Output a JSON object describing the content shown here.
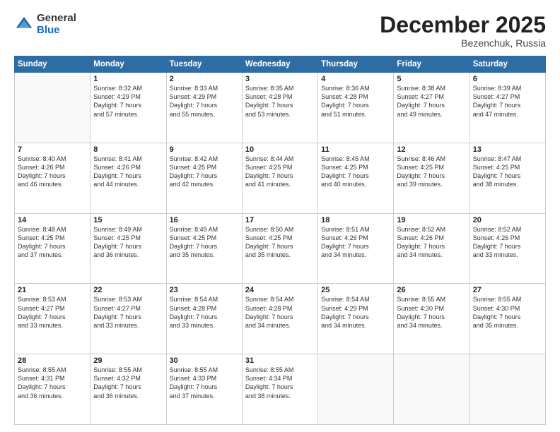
{
  "header": {
    "logo_general": "General",
    "logo_blue": "Blue",
    "month_title": "December 2025",
    "location": "Bezenchuk, Russia"
  },
  "days_of_week": [
    "Sunday",
    "Monday",
    "Tuesday",
    "Wednesday",
    "Thursday",
    "Friday",
    "Saturday"
  ],
  "weeks": [
    [
      {
        "day": "",
        "info": ""
      },
      {
        "day": "1",
        "info": "Sunrise: 8:32 AM\nSunset: 4:29 PM\nDaylight: 7 hours\nand 57 minutes."
      },
      {
        "day": "2",
        "info": "Sunrise: 8:33 AM\nSunset: 4:29 PM\nDaylight: 7 hours\nand 55 minutes."
      },
      {
        "day": "3",
        "info": "Sunrise: 8:35 AM\nSunset: 4:28 PM\nDaylight: 7 hours\nand 53 minutes."
      },
      {
        "day": "4",
        "info": "Sunrise: 8:36 AM\nSunset: 4:28 PM\nDaylight: 7 hours\nand 51 minutes."
      },
      {
        "day": "5",
        "info": "Sunrise: 8:38 AM\nSunset: 4:27 PM\nDaylight: 7 hours\nand 49 minutes."
      },
      {
        "day": "6",
        "info": "Sunrise: 8:39 AM\nSunset: 4:27 PM\nDaylight: 7 hours\nand 47 minutes."
      }
    ],
    [
      {
        "day": "7",
        "info": "Sunrise: 8:40 AM\nSunset: 4:26 PM\nDaylight: 7 hours\nand 46 minutes."
      },
      {
        "day": "8",
        "info": "Sunrise: 8:41 AM\nSunset: 4:26 PM\nDaylight: 7 hours\nand 44 minutes."
      },
      {
        "day": "9",
        "info": "Sunrise: 8:42 AM\nSunset: 4:25 PM\nDaylight: 7 hours\nand 42 minutes."
      },
      {
        "day": "10",
        "info": "Sunrise: 8:44 AM\nSunset: 4:25 PM\nDaylight: 7 hours\nand 41 minutes."
      },
      {
        "day": "11",
        "info": "Sunrise: 8:45 AM\nSunset: 4:25 PM\nDaylight: 7 hours\nand 40 minutes."
      },
      {
        "day": "12",
        "info": "Sunrise: 8:46 AM\nSunset: 4:25 PM\nDaylight: 7 hours\nand 39 minutes."
      },
      {
        "day": "13",
        "info": "Sunrise: 8:47 AM\nSunset: 4:25 PM\nDaylight: 7 hours\nand 38 minutes."
      }
    ],
    [
      {
        "day": "14",
        "info": "Sunrise: 8:48 AM\nSunset: 4:25 PM\nDaylight: 7 hours\nand 37 minutes."
      },
      {
        "day": "15",
        "info": "Sunrise: 8:49 AM\nSunset: 4:25 PM\nDaylight: 7 hours\nand 36 minutes."
      },
      {
        "day": "16",
        "info": "Sunrise: 8:49 AM\nSunset: 4:25 PM\nDaylight: 7 hours\nand 35 minutes."
      },
      {
        "day": "17",
        "info": "Sunrise: 8:50 AM\nSunset: 4:25 PM\nDaylight: 7 hours\nand 35 minutes."
      },
      {
        "day": "18",
        "info": "Sunrise: 8:51 AM\nSunset: 4:26 PM\nDaylight: 7 hours\nand 34 minutes."
      },
      {
        "day": "19",
        "info": "Sunrise: 8:52 AM\nSunset: 4:26 PM\nDaylight: 7 hours\nand 34 minutes."
      },
      {
        "day": "20",
        "info": "Sunrise: 8:52 AM\nSunset: 4:26 PM\nDaylight: 7 hours\nand 33 minutes."
      }
    ],
    [
      {
        "day": "21",
        "info": "Sunrise: 8:53 AM\nSunset: 4:27 PM\nDaylight: 7 hours\nand 33 minutes."
      },
      {
        "day": "22",
        "info": "Sunrise: 8:53 AM\nSunset: 4:27 PM\nDaylight: 7 hours\nand 33 minutes."
      },
      {
        "day": "23",
        "info": "Sunrise: 8:54 AM\nSunset: 4:28 PM\nDaylight: 7 hours\nand 33 minutes."
      },
      {
        "day": "24",
        "info": "Sunrise: 8:54 AM\nSunset: 4:28 PM\nDaylight: 7 hours\nand 34 minutes."
      },
      {
        "day": "25",
        "info": "Sunrise: 8:54 AM\nSunset: 4:29 PM\nDaylight: 7 hours\nand 34 minutes."
      },
      {
        "day": "26",
        "info": "Sunrise: 8:55 AM\nSunset: 4:30 PM\nDaylight: 7 hours\nand 34 minutes."
      },
      {
        "day": "27",
        "info": "Sunrise: 8:55 AM\nSunset: 4:30 PM\nDaylight: 7 hours\nand 35 minutes."
      }
    ],
    [
      {
        "day": "28",
        "info": "Sunrise: 8:55 AM\nSunset: 4:31 PM\nDaylight: 7 hours\nand 36 minutes."
      },
      {
        "day": "29",
        "info": "Sunrise: 8:55 AM\nSunset: 4:32 PM\nDaylight: 7 hours\nand 36 minutes."
      },
      {
        "day": "30",
        "info": "Sunrise: 8:55 AM\nSunset: 4:33 PM\nDaylight: 7 hours\nand 37 minutes."
      },
      {
        "day": "31",
        "info": "Sunrise: 8:55 AM\nSunset: 4:34 PM\nDaylight: 7 hours\nand 38 minutes."
      },
      {
        "day": "",
        "info": ""
      },
      {
        "day": "",
        "info": ""
      },
      {
        "day": "",
        "info": ""
      }
    ]
  ]
}
